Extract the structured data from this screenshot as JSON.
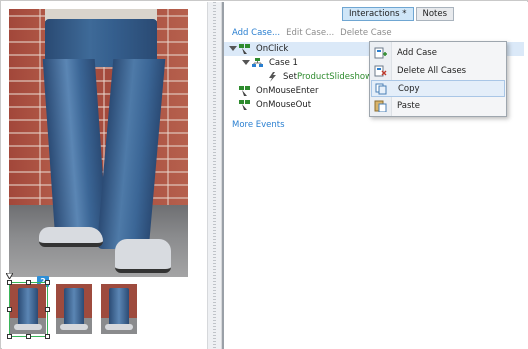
{
  "tabs": [
    {
      "label": "Interactions *",
      "active": true
    },
    {
      "label": "Notes",
      "active": false
    }
  ],
  "toolbar": {
    "add_case": "Add Case...",
    "edit_case": "Edit Case...",
    "delete_case": "Delete Case"
  },
  "tree": {
    "onclick": "OnClick",
    "case1": "Case 1",
    "action_prefix": "Set",
    "action_target": "ProductSlideshow t",
    "onmouseenter": "OnMouseEnter",
    "onmouseout": "OnMouseOut"
  },
  "more_events": "More Events",
  "context_menu": [
    {
      "label": "Add Case",
      "icon": "add-case-icon"
    },
    {
      "label": "Delete All Cases",
      "icon": "delete-all-cases-icon"
    },
    {
      "label": "Copy",
      "icon": "copy-icon"
    },
    {
      "label": "Paste",
      "icon": "paste-icon"
    }
  ],
  "canvas": {
    "selected_badge": "2"
  },
  "colors": {
    "link": "#2a7fd0",
    "accent_green": "#2e8b2e",
    "selection_blue": "#dbe9f8",
    "badge_blue": "#2d8fd8"
  }
}
